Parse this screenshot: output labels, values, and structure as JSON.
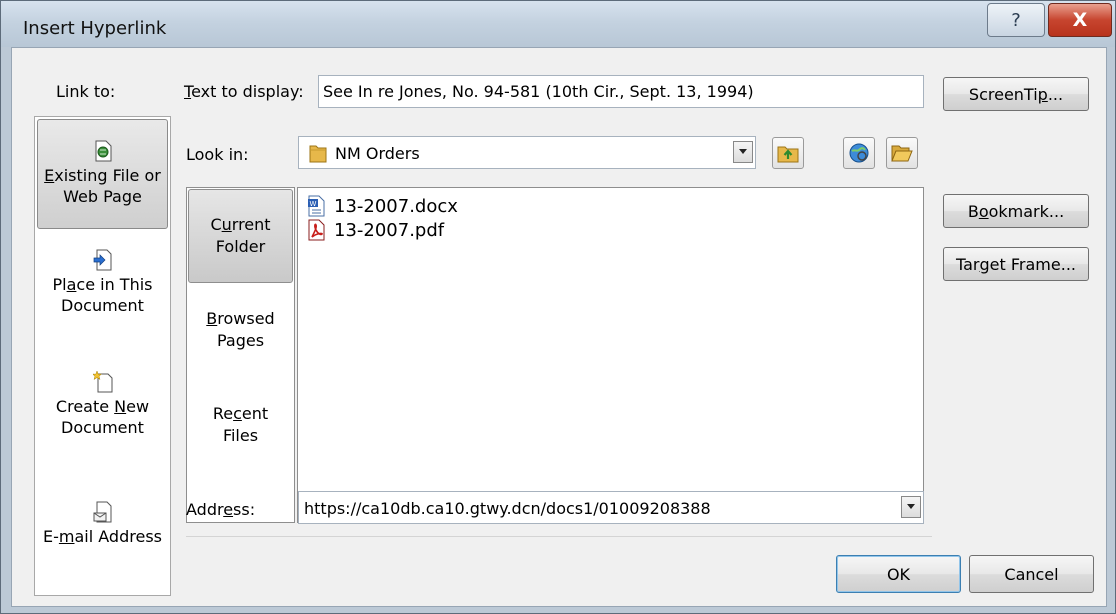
{
  "dialog": {
    "title": "Insert Hyperlink",
    "help_glyph": "?",
    "close_glyph": "X"
  },
  "link_to": {
    "label": "Link to:",
    "items": [
      {
        "line1_pre": "",
        "line1_u": "E",
        "line1_post": "xisting File or",
        "line2_pre": "Web Page",
        "line2_u": "",
        "line2_post": "",
        "icon": "file-web-icon"
      },
      {
        "line1_pre": "Pl",
        "line1_u": "a",
        "line1_post": "ce in This",
        "line2_pre": "Document",
        "line2_u": "",
        "line2_post": "",
        "icon": "place-in-document-icon"
      },
      {
        "line1_pre": "Create ",
        "line1_u": "N",
        "line1_post": "ew",
        "line2_pre": "Document",
        "line2_u": "",
        "line2_post": "",
        "icon": "new-document-icon"
      },
      {
        "line1_pre": "E-",
        "line1_u": "m",
        "line1_post": "ail Address",
        "line2_pre": "",
        "line2_u": "",
        "line2_post": "",
        "icon": "email-icon"
      }
    ]
  },
  "text_to_display": {
    "label_u": "T",
    "label_rest": "ext to display:",
    "value": "See In re Jones, No. 94-581 (10th Cir., Sept. 13, 1994)"
  },
  "screentip_button": {
    "pre": "ScreenTi",
    "u": "p",
    "post": "..."
  },
  "look_in": {
    "label_pre": "Look in:",
    "value": "NM Orders"
  },
  "look_buttons": [
    {
      "line1_pre": "C",
      "line1_u": "u",
      "line1_post": "rrent",
      "line2": "Folder"
    },
    {
      "line1_pre": "",
      "line1_u": "B",
      "line1_post": "rowsed",
      "line2": "Pages"
    },
    {
      "line1_pre": "Re",
      "line1_u": "c",
      "line1_post": "ent",
      "line2": "Files"
    }
  ],
  "files": [
    {
      "name": "13-2007.docx",
      "icon": "word-doc-icon"
    },
    {
      "name": "13-2007.pdf",
      "icon": "pdf-icon"
    }
  ],
  "bookmark_button": {
    "pre": "B",
    "u": "o",
    "post": "okmark..."
  },
  "target_frame_button": {
    "pre": "Tar",
    "u": "g",
    "post": "et Frame..."
  },
  "address": {
    "label_pre": "Addr",
    "label_u": "e",
    "label_post": "ss:",
    "value": "https://ca10db.ca10.gtwy.dcn/docs1/01009208388"
  },
  "ok_button": "OK",
  "cancel_button": "Cancel"
}
